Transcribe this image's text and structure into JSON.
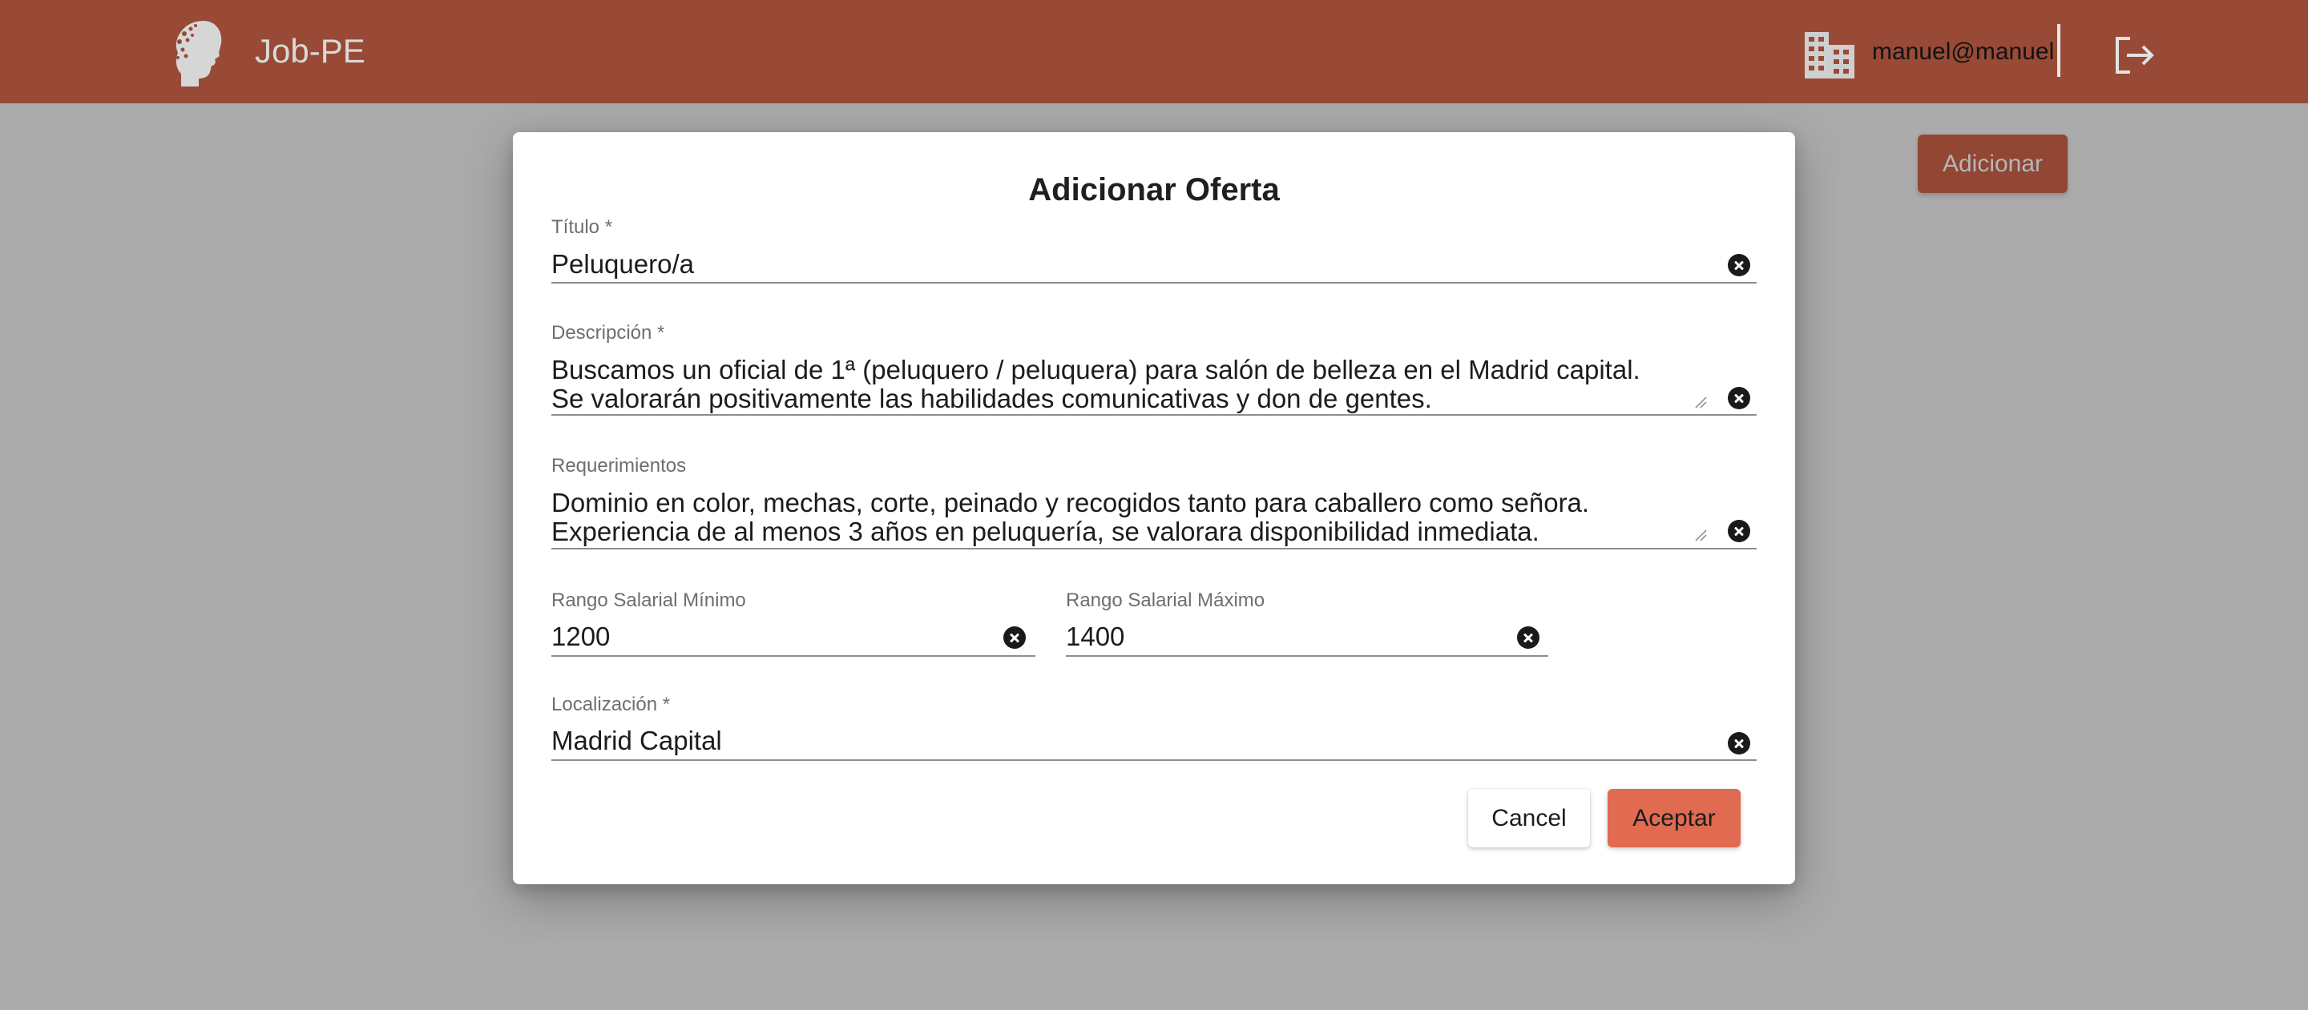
{
  "header": {
    "brand": "Job-PE",
    "logo_icon": "woman-profile-logo-icon",
    "company_icon": "building-icon",
    "user": "manuel@manuel",
    "logout_icon": "logout-icon"
  },
  "main": {
    "add_button": "Adicionar"
  },
  "dialog": {
    "title": "Adicionar Oferta",
    "fields": {
      "titulo": {
        "label": "Título *",
        "value": "Peluquero/a"
      },
      "descripcion": {
        "label": "Descripción *",
        "value": "Buscamos un oficial de 1ª (peluquero / peluquera) para salón de belleza en el Madrid capital.\nSe valorarán positivamente las habilidades comunicativas y don de gentes."
      },
      "requerimientos": {
        "label": "Requerimientos",
        "value": "Dominio en color, mechas, corte, peinado y recogidos tanto para caballero como señora.\nExperiencia de al menos 3 años en peluquería, se valorara disponibilidad inmediata."
      },
      "salario_min": {
        "label": "Rango Salarial Mínimo",
        "value": "1200"
      },
      "salario_max": {
        "label": "Rango Salarial Máximo",
        "value": "1400"
      },
      "localizacion": {
        "label": "Localización *",
        "value": "Madrid Capital"
      }
    },
    "cancel": "Cancel",
    "accept": "Aceptar"
  },
  "colors": {
    "appbar": "#984a36",
    "accent": "#e06b50",
    "backdrop": "#ababab"
  }
}
